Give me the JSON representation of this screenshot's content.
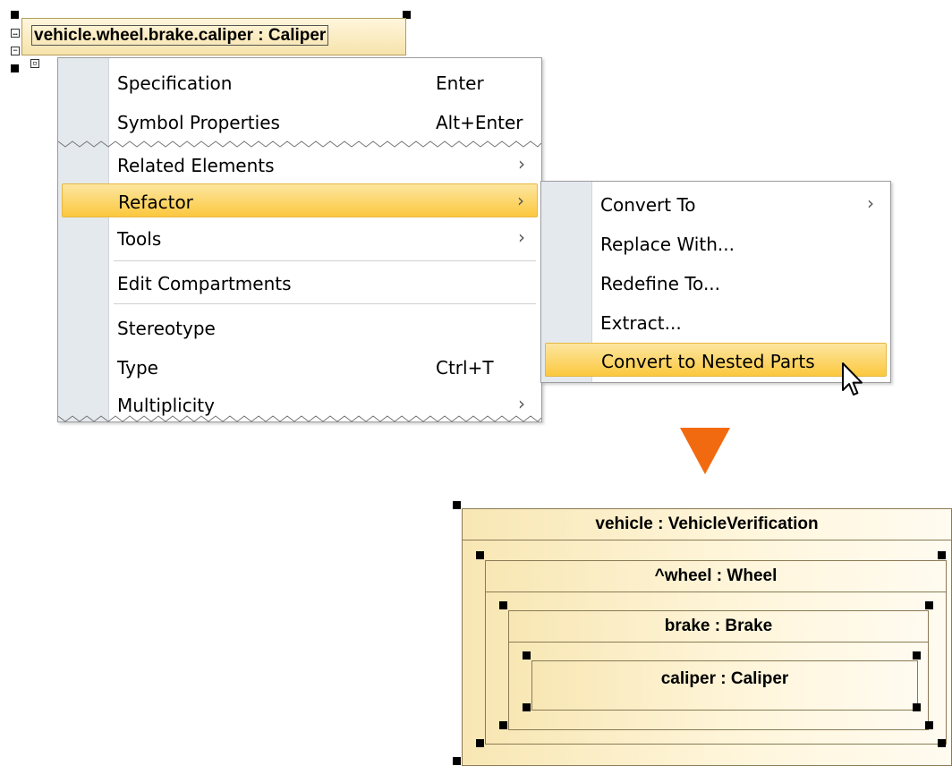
{
  "source_part": {
    "label": "vehicle.wheel.brake.caliper : Caliper"
  },
  "context_menu": {
    "items": [
      {
        "label": "Specification",
        "shortcut": "Enter"
      },
      {
        "label": "Symbol Properties",
        "shortcut": "Alt+Enter"
      },
      {
        "label": "Related Elements",
        "submenu": true
      },
      {
        "label": "Refactor",
        "submenu": true,
        "selected": true
      },
      {
        "label": "Tools",
        "submenu": true
      },
      {
        "label": "Edit Compartments"
      },
      {
        "label": "Stereotype"
      },
      {
        "label": "Type",
        "shortcut": "Ctrl+T"
      },
      {
        "label": "Multiplicity",
        "submenu": true
      }
    ],
    "submenu_glyph": "›"
  },
  "refactor_submenu": {
    "items": [
      {
        "label": "Convert To",
        "submenu": true
      },
      {
        "label": "Replace With..."
      },
      {
        "label": "Redefine To..."
      },
      {
        "label": "Extract..."
      },
      {
        "label": "Convert to Nested Parts",
        "selected": true
      }
    ]
  },
  "result": {
    "arrow_color": "#f26a10",
    "parts": [
      {
        "title": "vehicle : VehicleVerification"
      },
      {
        "title": "^wheel : Wheel"
      },
      {
        "title": "brake : Brake"
      },
      {
        "title": "caliper : Caliper"
      }
    ]
  },
  "icons": {
    "cursor": "mouse-pointer-icon",
    "arrow": "down-triangle-icon"
  }
}
